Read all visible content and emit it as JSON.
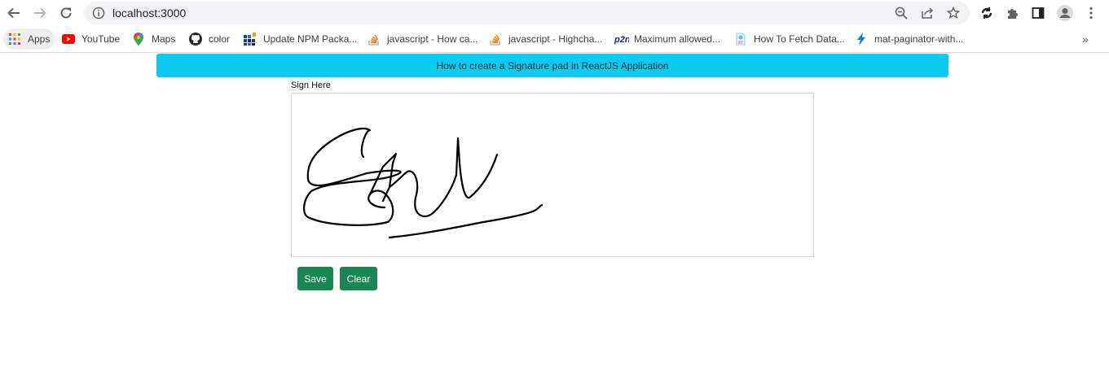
{
  "browser": {
    "url": "localhost:3000",
    "bookmarks": [
      {
        "label": "Apps",
        "icon": "apps-grid-icon"
      },
      {
        "label": "YouTube",
        "icon": "youtube-icon"
      },
      {
        "label": "Maps",
        "icon": "maps-pin-icon"
      },
      {
        "label": "color",
        "icon": "github-icon"
      },
      {
        "label": "Update NPM Packa...",
        "icon": "grid-logo-icon"
      },
      {
        "label": "javascript - How ca...",
        "icon": "stackoverflow-icon"
      },
      {
        "label": "javascript - Highcha...",
        "icon": "stackoverflow-icon"
      },
      {
        "label": "Maximum allowed...",
        "icon": "p2n-icon"
      },
      {
        "label": "How To Fetch Data...",
        "icon": "page-icon"
      },
      {
        "label": "mat-paginator-with...",
        "icon": "lightning-icon"
      }
    ],
    "more_bookmarks": "»"
  },
  "page": {
    "banner_text": "How to create a Signature pad in ReactJS Application",
    "sign_label": "Sign Here",
    "save_label": "Save",
    "clear_label": "Clear"
  },
  "colors": {
    "banner": "#0dcaf0",
    "button": "#198754",
    "signature_ink": "#000000"
  }
}
